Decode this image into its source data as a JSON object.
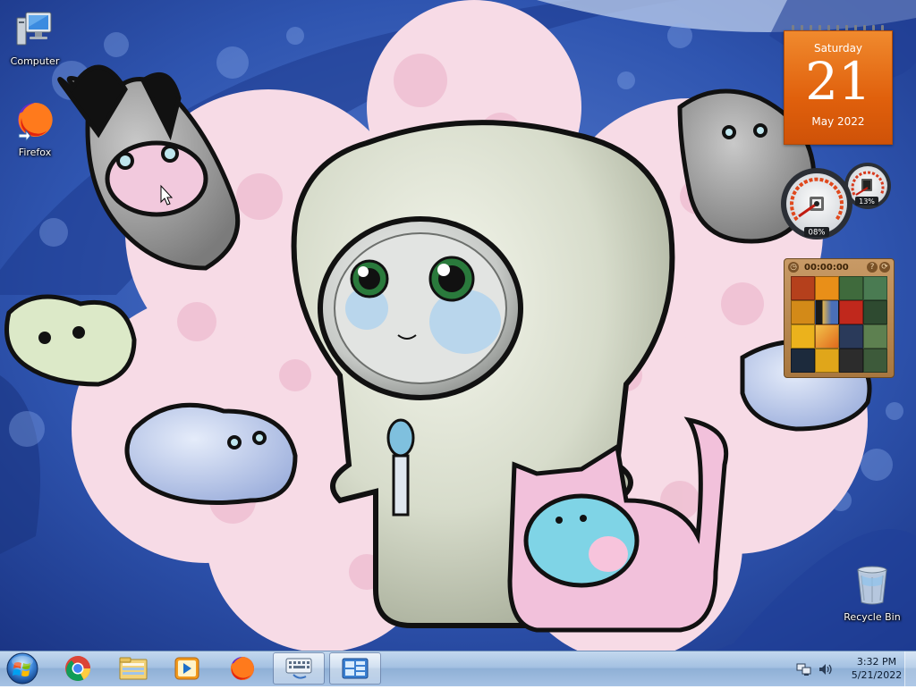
{
  "desktop": {
    "icons": [
      {
        "label": "Computer",
        "icon": "computer-icon"
      },
      {
        "label": "Firefox",
        "icon": "firefox-icon"
      },
      {
        "label": "Recycle Bin",
        "icon": "recycle-bin-icon"
      }
    ]
  },
  "gadgets": {
    "calendar": {
      "weekday": "Saturday",
      "day": "21",
      "month_year": "May 2022"
    },
    "cpu_meter": {
      "cpu_label": "08%",
      "cpu_value": 8,
      "memory_label": "13%",
      "memory_value": 13
    },
    "puzzle": {
      "timer": "00:00:00",
      "help_label": "?",
      "shuffle_label": "⟳"
    }
  },
  "taskbar": {
    "start_icon": "windows-start-orb",
    "items": [
      {
        "name": "chrome",
        "icon": "chrome-icon"
      },
      {
        "name": "explorer",
        "icon": "file-explorer-icon"
      },
      {
        "name": "media-player",
        "icon": "windows-media-player-icon"
      },
      {
        "name": "firefox",
        "icon": "firefox-icon"
      },
      {
        "name": "on-screen-keyboard",
        "icon": "keyboard-icon",
        "active": true
      },
      {
        "name": "gadgets",
        "icon": "desktop-gadgets-icon",
        "active": true
      }
    ],
    "tray": {
      "time": "3:32 PM",
      "date": "5/21/2022",
      "network_icon": "network-icon",
      "volume_icon": "speaker-icon"
    }
  },
  "colors": {
    "calendar_orange": "#e2650f",
    "taskbar": "#a4c1e2",
    "wallpaper_blue": "#2a4fa8",
    "wallpaper_pink": "#f3c6d8"
  }
}
